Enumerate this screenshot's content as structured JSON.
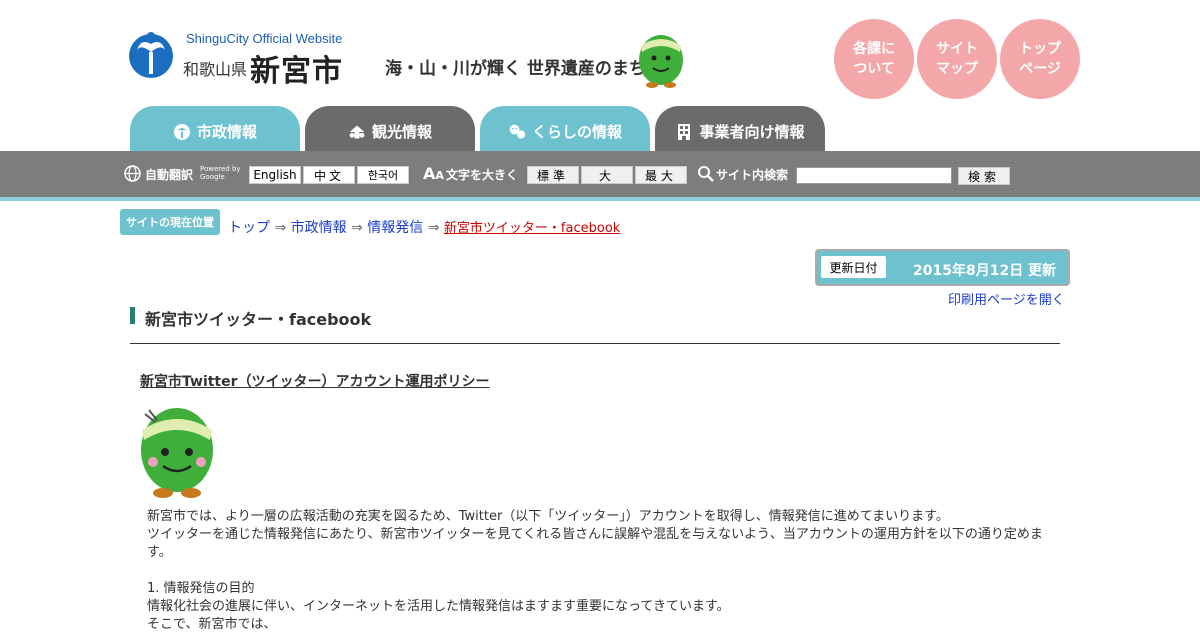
{
  "header": {
    "site_en": "ShinguCity Official Website",
    "prefecture": "和歌山県",
    "city": "新宮市",
    "tagline": "海・山・川が輝く 世界遺産のまち"
  },
  "round_buttons": [
    {
      "line1": "各課に",
      "line2": "ついて"
    },
    {
      "line1": "サイト",
      "line2": "マップ"
    },
    {
      "line1": "トップ",
      "line2": "ページ"
    }
  ],
  "tabs": [
    {
      "label": "市政情報",
      "color": "#6ec1cf"
    },
    {
      "label": "観光情報",
      "color": "#6b6b6b"
    },
    {
      "label": "くらしの情報",
      "color": "#6ec1cf"
    },
    {
      "label": "事業者向け情報",
      "color": "#6b6b6b"
    }
  ],
  "toolbar": {
    "translate_label": "自動翻訳",
    "powered_line1": "Powered by",
    "powered_line2": "Google",
    "languages": [
      "English",
      "中文",
      "한국어"
    ],
    "font_size_label": "文字を大きく",
    "font_sizes": [
      "標準",
      "大",
      "最大"
    ],
    "search_label": "サイト内検索",
    "search_value": "",
    "search_button": "検索"
  },
  "breadcrumb": {
    "label": "サイトの現在位置",
    "items": [
      "トップ",
      "市政情報",
      "情報発信"
    ],
    "separator": "⇒",
    "current": "新宮市ツイッター・facebook"
  },
  "update": {
    "tag": "更新日付",
    "date": "2015年8月12日 更新",
    "print_link": "印刷用ページを開く"
  },
  "page": {
    "title": "新宮市ツイッター・facebook",
    "subheading": "新宮市Twitter（ツイッター）アカウント運用ポリシー",
    "paragraphs": [
      "新宮市では、より一層の広報活動の充実を図るため、Twitter（以下「ツイッター」）アカウントを取得し、情報発信に進めてまいります。",
      "ツイッターを通じた情報発信にあたり、新宮市ツイッターを見てくれる皆さんに誤解や混乱を与えないよう、当アカウントの運用方針を以下の通り定めます。",
      "",
      "1. 情報発信の目的",
      "情報化社会の進展に伴い、インターネットを活用した情報発信はますます重要になってきています。",
      "そこで、新宮市では、"
    ]
  },
  "colors": {
    "accent_teal": "#6ec1cf",
    "bar_gray": "#7d7d7d",
    "pink": "#f4a7a9",
    "link_blue": "#1a3ccf",
    "current_red": "#cc0000"
  }
}
